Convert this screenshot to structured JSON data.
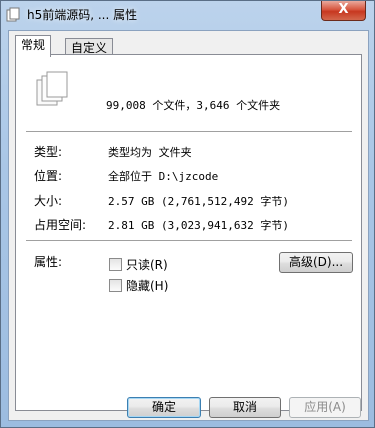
{
  "window": {
    "title": "h5前端源码, ... 属性",
    "close_label": "X"
  },
  "tabs": [
    {
      "label": "常规"
    },
    {
      "label": "自定义"
    }
  ],
  "summary": {
    "text": "99,008 个文件，3,646 个文件夹"
  },
  "info": {
    "type_label": "类型:",
    "type_value": "类型均为 文件夹",
    "location_label": "位置:",
    "location_value": "全部位于 D:\\jzcode",
    "size_label": "大小:",
    "size_value": "2.57 GB (2,761,512,492 字节)",
    "disk_label": "占用空间:",
    "disk_value": "2.81 GB (3,023,941,632 字节)"
  },
  "attributes": {
    "label": "属性:",
    "readonly_label": "只读(R)",
    "hidden_label": "隐藏(H)",
    "advanced_label": "高级(D)..."
  },
  "buttons": {
    "ok": "确定",
    "cancel": "取消",
    "apply": "应用(A)"
  }
}
